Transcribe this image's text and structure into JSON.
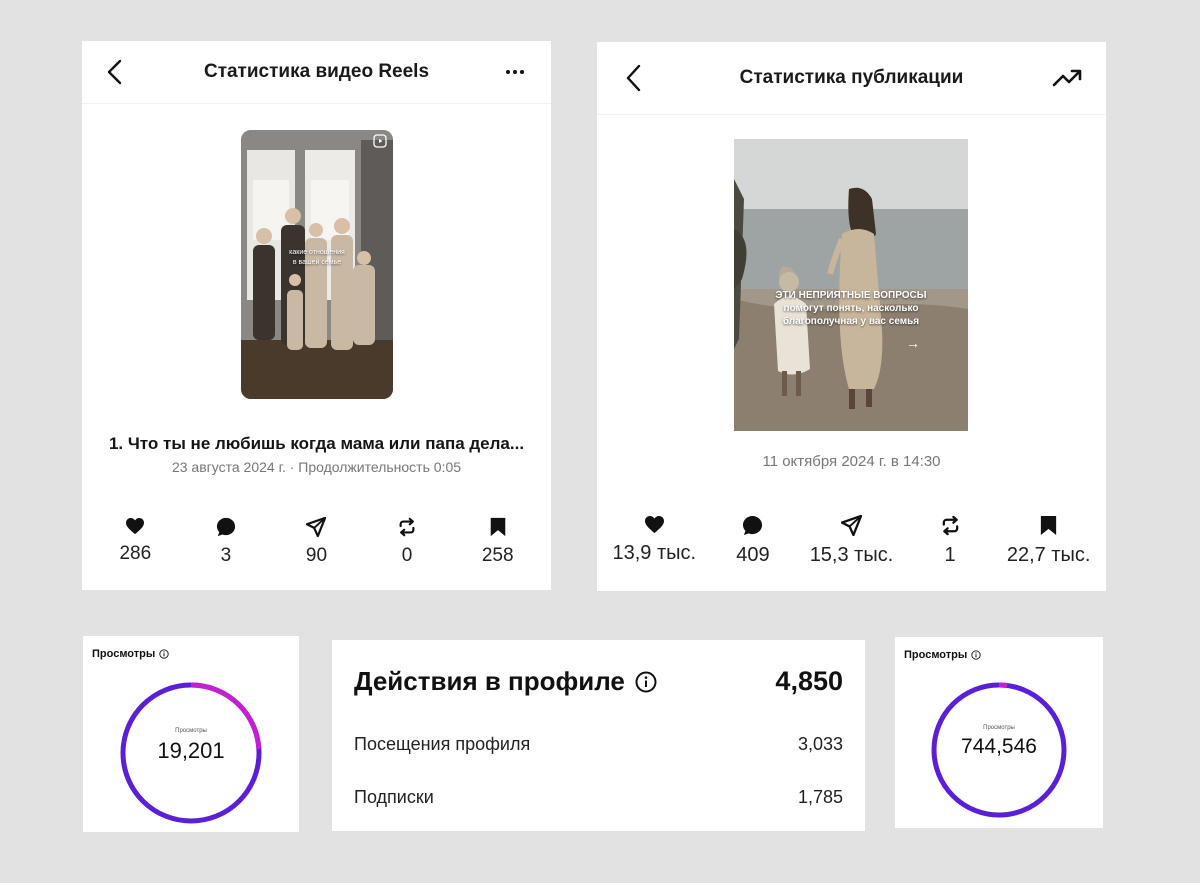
{
  "reels_card": {
    "title": "Статистика видео Reels",
    "thumb_text": "какие отношения\nв вашей семье",
    "post_title": "1. Что ты не любишь когда мама или папа дела...",
    "meta": "23 августа 2024 г. · Продолжительность 0:05",
    "stats": [
      {
        "icon": "heart-icon",
        "value": "286"
      },
      {
        "icon": "comment-icon",
        "value": "3"
      },
      {
        "icon": "share-icon",
        "value": "90"
      },
      {
        "icon": "repost-icon",
        "value": "0"
      },
      {
        "icon": "bookmark-icon",
        "value": "258"
      }
    ]
  },
  "post_card": {
    "title": "Статистика публикации",
    "thumb_text": "ЭТИ НЕПРИЯТНЫЕ ВОПРОСЫ\nпомогут понять, насколько\nблагополучная у вас семья",
    "arrow": "→",
    "meta": "11 октября 2024 г. в 14:30",
    "stats": [
      {
        "icon": "heart-icon",
        "value": "13,9 тыс."
      },
      {
        "icon": "comment-icon",
        "value": "409"
      },
      {
        "icon": "share-icon",
        "value": "15,3 тыс."
      },
      {
        "icon": "repost-icon",
        "value": "1"
      },
      {
        "icon": "bookmark-icon",
        "value": "22,7 тыс."
      }
    ]
  },
  "views_left": {
    "title": "Просмотры",
    "center_label": "Просмотры",
    "value": "19,201",
    "accent_fraction": 0.24
  },
  "profile_actions": {
    "title": "Действия в профиле",
    "total": "4,850",
    "rows": [
      {
        "label": "Посещения профиля",
        "value": "3,033"
      },
      {
        "label": "Подписки",
        "value": "1,785"
      }
    ]
  },
  "views_right": {
    "title": "Просмотры",
    "center_label": "Просмотры",
    "value": "744,546",
    "accent_fraction": 0.02
  },
  "colors": {
    "ring_main": "#5a1fd6",
    "ring_accent": "#c41fd0",
    "background": "#e2e2e2"
  }
}
